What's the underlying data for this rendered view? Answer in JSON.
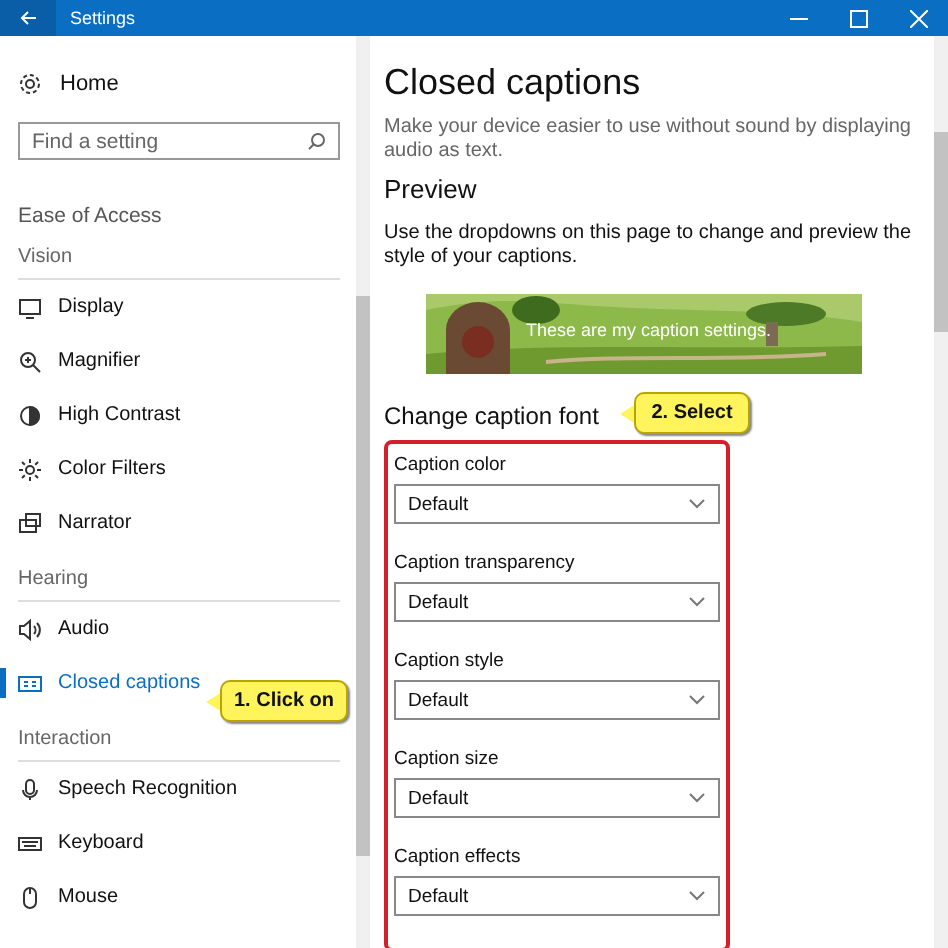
{
  "window": {
    "title": "Settings"
  },
  "sidebar": {
    "home": "Home",
    "search": {
      "placeholder": "Find a setting"
    },
    "section": "Ease of Access",
    "groups": [
      {
        "heading": "Vision",
        "items": [
          {
            "label": "Display",
            "kind": "display",
            "selected": false
          },
          {
            "label": "Magnifier",
            "kind": "magnifier",
            "selected": false
          },
          {
            "label": "High Contrast",
            "kind": "contrast",
            "selected": false
          },
          {
            "label": "Color Filters",
            "kind": "sun",
            "selected": false
          },
          {
            "label": "Narrator",
            "kind": "narrator",
            "selected": false
          }
        ]
      },
      {
        "heading": "Hearing",
        "items": [
          {
            "label": "Audio",
            "kind": "audio",
            "selected": false
          },
          {
            "label": "Closed captions",
            "kind": "cc",
            "selected": true
          }
        ]
      },
      {
        "heading": "Interaction",
        "items": [
          {
            "label": "Speech Recognition",
            "kind": "mic",
            "selected": false
          },
          {
            "label": "Keyboard",
            "kind": "keyboard",
            "selected": false
          },
          {
            "label": "Mouse",
            "kind": "mouse",
            "selected": false
          }
        ]
      }
    ]
  },
  "page": {
    "title": "Closed captions",
    "description": "Make your device easier to use without sound by displaying audio as text.",
    "preview_heading": "Preview",
    "preview_text": "Use the dropdowns on this page to change and preview the style of your captions.",
    "preview_caption": "These are my caption settings.",
    "font_heading": "Change caption font",
    "dropdowns": [
      {
        "label": "Caption color",
        "value": "Default"
      },
      {
        "label": "Caption transparency",
        "value": "Default"
      },
      {
        "label": "Caption style",
        "value": "Default"
      },
      {
        "label": "Caption size",
        "value": "Default"
      },
      {
        "label": "Caption effects",
        "value": "Default"
      }
    ]
  },
  "callouts": [
    "1. Click on",
    "2. Select"
  ]
}
